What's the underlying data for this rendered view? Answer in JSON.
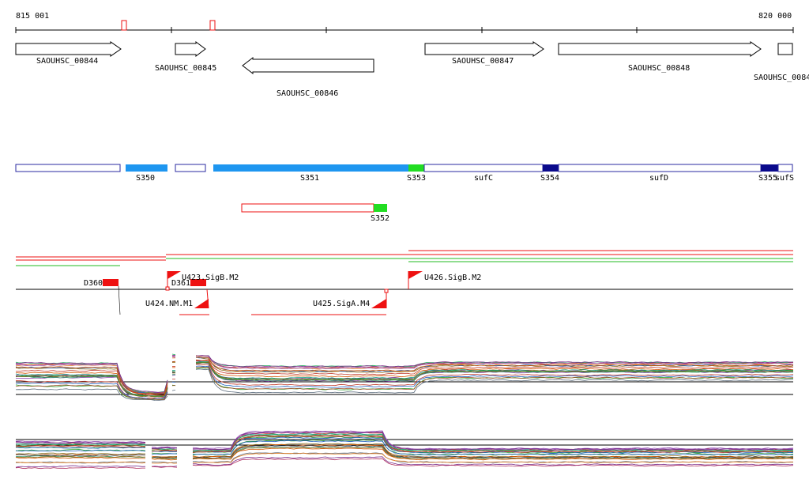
{
  "coordinate_start": "815 001",
  "coordinate_end": "820 000",
  "genes": [
    {
      "label": "SAOUHSC_00844",
      "strand": "+"
    },
    {
      "label": "SAOUHSC_00845",
      "strand": "+"
    },
    {
      "label": "SAOUHSC_00846",
      "strand": "-"
    },
    {
      "label": "SAOUHSC_00847",
      "strand": "+"
    },
    {
      "label": "SAOUHSC_00848",
      "strand": "+"
    },
    {
      "label": "SAOUHSC_0084",
      "strand": "+"
    }
  ],
  "segments": [
    {
      "label": "S350"
    },
    {
      "label": "S351"
    },
    {
      "label": "S352"
    },
    {
      "label": "S353"
    },
    {
      "label": "sufC"
    },
    {
      "label": "S354"
    },
    {
      "label": "sufD"
    },
    {
      "label": "S355"
    },
    {
      "label": "sufS"
    }
  ],
  "features": [
    {
      "label": "D360"
    },
    {
      "label": "D361"
    },
    {
      "label": "U423.SigB.M2"
    },
    {
      "label": "U424.NM.M1"
    },
    {
      "label": "U425.SigA.M4"
    },
    {
      "label": "U426.SigB.M2"
    }
  ],
  "colors": {
    "segment_blue": "#1e96f0",
    "segment_green": "#22dd22",
    "segment_navy": "#0a0a8c",
    "segment_outline": "#2a2aa0",
    "feature_red": "#ee1111",
    "promoter_red": "#ee1111",
    "line_green": "#22bb22"
  }
}
